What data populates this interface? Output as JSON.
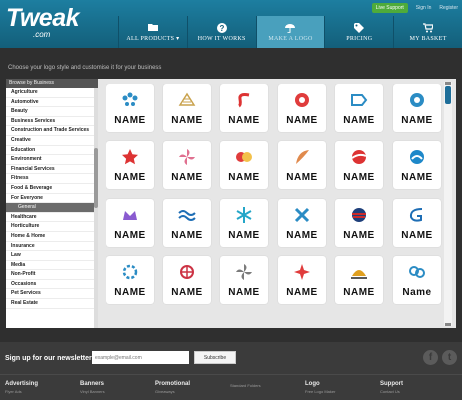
{
  "header": {
    "logo": "Tweak",
    "logo_sub": ".com",
    "live_support": "Live Support",
    "sign_in": "Sign In",
    "register": "Register",
    "nav": [
      {
        "label": "ALL PRODUCTS ▾",
        "icon": "folder-icon"
      },
      {
        "label": "HOW IT WORKS",
        "icon": "question-icon"
      },
      {
        "label": "MAKE A LOGO",
        "icon": "umbrella-icon",
        "active": true
      },
      {
        "label": "PRICING",
        "icon": "tag-icon"
      },
      {
        "label": "MY BASKET",
        "icon": "cart-icon"
      }
    ]
  },
  "main": {
    "instruction": "Choose your logo style and customise it for your business",
    "sidebar_header": "Browse by Business",
    "categories": [
      "Agriculture",
      "Automotive",
      "Beauty",
      "Business Services",
      "Construction and Trade Services",
      "Creative",
      "Education",
      "Environment",
      "Financial Services",
      "Fitness",
      "Food & Beverage",
      "For Everyone",
      "General",
      "Healthcare",
      "Horticulture",
      "Home & Home",
      "Insurance",
      "Law",
      "Media",
      "Non-Profit",
      "Occasions",
      "Pet Services",
      "Real Estate"
    ],
    "selected_category": "General",
    "logo_tiles": [
      {
        "name": "NAME",
        "icon": "droplets-icon",
        "color": "#2b8cc4"
      },
      {
        "name": "NAME",
        "icon": "book-stripes-icon",
        "color": "#c9a24d"
      },
      {
        "name": "NAME",
        "icon": "s-swirl-icon",
        "color": "#d33"
      },
      {
        "name": "NAME",
        "icon": "flower-icon",
        "color": "#e03c3c"
      },
      {
        "name": "NAME",
        "icon": "stripe-arrow-icon",
        "color": "#2b8cc4"
      },
      {
        "name": "NAME",
        "icon": "gear-flower-icon",
        "color": "#2b8cc4"
      },
      {
        "name": "NAME",
        "icon": "star-icon",
        "color": "#d33"
      },
      {
        "name": "NAME",
        "icon": "pinwheel-icon",
        "color": "#e07090"
      },
      {
        "name": "NAME",
        "icon": "circles-icon",
        "color": "#e03c3c"
      },
      {
        "name": "NAME",
        "icon": "feather-icon",
        "color": "#e08a4d"
      },
      {
        "name": "NAME",
        "icon": "swoosh-ball-icon",
        "color": "#d33"
      },
      {
        "name": "NAME",
        "icon": "wave-circle-icon",
        "color": "#1e88c9"
      },
      {
        "name": "NAME",
        "icon": "crown-icon",
        "color": "#8a5bd0"
      },
      {
        "name": "NAME",
        "icon": "waves-icon",
        "color": "#1e6eb5"
      },
      {
        "name": "NAME",
        "icon": "snowflake-icon",
        "color": "#25a6c8"
      },
      {
        "name": "NAME",
        "icon": "cross-swirl-icon",
        "color": "#2b8cc4"
      },
      {
        "name": "NAME",
        "icon": "globe-stripes-icon",
        "color": "#cc2a2a"
      },
      {
        "name": "NAME",
        "icon": "ribbon-g-icon",
        "color": "#1e6eb5"
      },
      {
        "name": "NAME",
        "icon": "ring-dots-icon",
        "color": "#2b8cc4"
      },
      {
        "name": "NAME",
        "icon": "lattice-icon",
        "color": "#c34"
      },
      {
        "name": "NAME",
        "icon": "pinwheel-icon",
        "color": "#7b7b7b"
      },
      {
        "name": "NAME",
        "icon": "sparkle-icon",
        "color": "#e03c3c"
      },
      {
        "name": "NAME",
        "icon": "sun-icon",
        "color": "#e0a020"
      },
      {
        "name": "Name",
        "icon": "knot-icon",
        "color": "#2b8cc4"
      }
    ]
  },
  "footer": {
    "newsletter_label": "Sign up for our newsletter:",
    "email_placeholder": "example@email.com",
    "subscribe": "Subscribe",
    "social": [
      "f",
      "t"
    ],
    "columns": [
      {
        "title": "Advertising",
        "sub": "Flyer Ads"
      },
      {
        "title": "Banners",
        "sub": "Vinyl Banners"
      },
      {
        "title": "Promotional",
        "sub": "Giveaways"
      },
      {
        "title": "",
        "sub": "Standard Folders"
      },
      {
        "title": "Logo",
        "sub": "Free Logo Maker"
      },
      {
        "title": "Support",
        "sub": "Contact Us"
      }
    ]
  }
}
